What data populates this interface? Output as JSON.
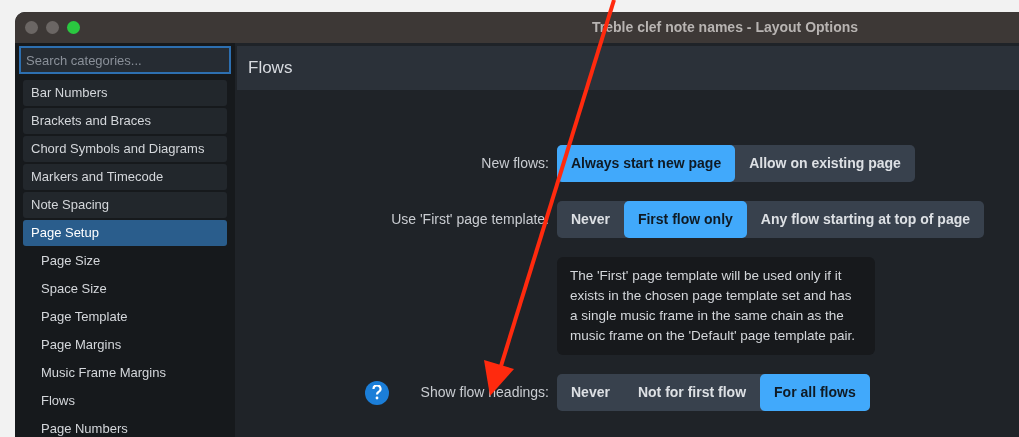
{
  "window": {
    "title": "Treble clef note names - Layout Options"
  },
  "search": {
    "placeholder": "Search categories..."
  },
  "sidebar": {
    "items": [
      {
        "label": "Bar Numbers",
        "selected": false
      },
      {
        "label": "Brackets and Braces",
        "selected": false
      },
      {
        "label": "Chord Symbols and Diagrams",
        "selected": false
      },
      {
        "label": "Markers and Timecode",
        "selected": false
      },
      {
        "label": "Note Spacing",
        "selected": false
      },
      {
        "label": "Page Setup",
        "selected": true,
        "children": [
          {
            "label": "Page Size",
            "selected": false
          },
          {
            "label": "Space Size",
            "selected": false
          },
          {
            "label": "Page Template",
            "selected": false
          },
          {
            "label": "Page Margins",
            "selected": false
          },
          {
            "label": "Music Frame Margins",
            "selected": false
          },
          {
            "label": "Flows",
            "selected": false
          },
          {
            "label": "Page Numbers",
            "selected": false
          }
        ]
      }
    ]
  },
  "panel": {
    "title": "Flows",
    "rows": [
      {
        "kind": "options",
        "help": false,
        "label": "New flows:",
        "options": [
          {
            "label": "Always start new page",
            "selected": true
          },
          {
            "label": "Allow on existing page",
            "selected": false
          }
        ]
      },
      {
        "kind": "options",
        "help": false,
        "label": "Use 'First' page template:",
        "options": [
          {
            "label": "Never",
            "selected": false
          },
          {
            "label": "First flow only",
            "selected": true
          },
          {
            "label": "Any flow starting at top of page",
            "selected": false
          }
        ]
      },
      {
        "kind": "note",
        "text": "The 'First' page template will be used only if it exists in the chosen page template set and has a single music frame in the same chain as the music frame on the 'Default' page template pair."
      },
      {
        "kind": "options",
        "help": true,
        "label": "Show flow headings:",
        "options": [
          {
            "label": "Never",
            "selected": false
          },
          {
            "label": "Not for first flow",
            "selected": false
          },
          {
            "label": "For all flows",
            "selected": true
          }
        ]
      }
    ]
  }
}
